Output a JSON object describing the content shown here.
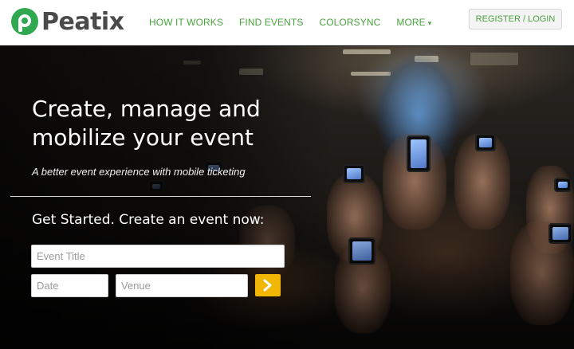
{
  "brand": {
    "name": "Peatix",
    "logo_icon": "peatix-p-icon",
    "color": "#2fa84f"
  },
  "nav": {
    "items": [
      {
        "label": "HOW IT WORKS"
      },
      {
        "label": "FIND EVENTS"
      },
      {
        "label": "COLORSYNC"
      },
      {
        "label": "MORE"
      }
    ],
    "more_caret": "▾",
    "login_label": "REGISTER / LOGIN",
    "link_color": "#4aa23f"
  },
  "hero": {
    "headline_line1": "Create, manage and",
    "headline_line2": "mobilize your event",
    "subhead": "A better event experience with mobile ticketing",
    "cta_heading": "Get Started. Create an event now:",
    "form": {
      "title_placeholder": "Event Title",
      "date_placeholder": "Date",
      "venue_placeholder": "Venue",
      "submit_icon": "chevron-right-icon",
      "submit_color": "#f2b705"
    }
  }
}
